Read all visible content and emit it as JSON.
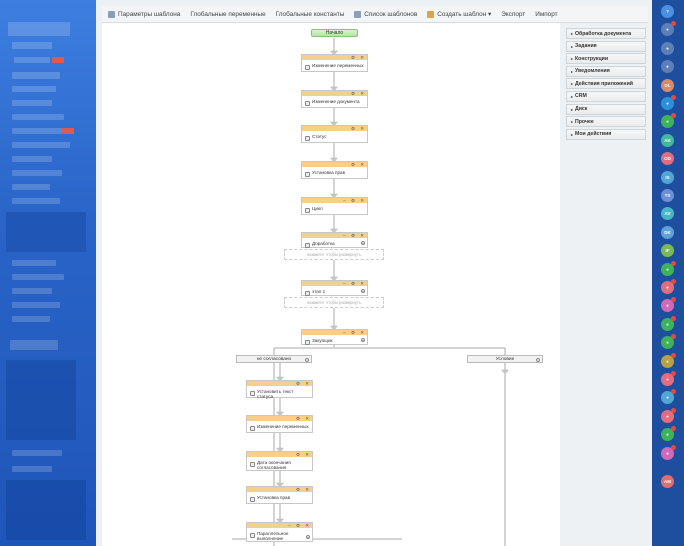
{
  "toolbar": [
    {
      "label": "Параметры шаблона",
      "icon": "settings-icon",
      "color": "#8aa0b8"
    },
    {
      "label": "Глобальные переменные",
      "icon": "",
      "color": ""
    },
    {
      "label": "Глобальные константы",
      "icon": "",
      "color": ""
    },
    {
      "label": "Список шаблонов",
      "icon": "list-icon",
      "color": "#8aa0b8"
    },
    {
      "label": "Создать шаблон ▾",
      "icon": "new-template-icon",
      "color": "#d9a44a"
    },
    {
      "label": "Экспорт",
      "icon": "",
      "color": ""
    },
    {
      "label": "Импорт",
      "icon": "",
      "color": ""
    }
  ],
  "palette": [
    "Обработка документа",
    "Задания",
    "Конструкции",
    "Уведомления",
    "Действия приложений",
    "CRM",
    "Диск",
    "Прочее",
    "Мои действия"
  ],
  "workflow": {
    "start": "Начало",
    "blocks": [
      {
        "title": "Изменение переменных"
      },
      {
        "title": "Изменение документа"
      },
      {
        "title": "Статус"
      },
      {
        "title": "Установка прав"
      },
      {
        "title": "Цикл"
      },
      {
        "title": "Доработка"
      },
      {
        "title": "этап 1"
      },
      {
        "title": "Закупщик"
      }
    ],
    "expand_hint": "нажмите, чтобы развернуть",
    "branches": [
      "не согласовано",
      "Условие"
    ],
    "left_branch_blocks": [
      {
        "title": "Установить текст статуса"
      },
      {
        "title": "Изменение переменных"
      },
      {
        "title": "Дата окончания согласования"
      },
      {
        "title": "Установка прав"
      },
      {
        "title": "Параллельное выполнение"
      }
    ]
  },
  "rail": [
    {
      "text": "?",
      "color": "#4a90e2",
      "badge": false
    },
    {
      "text": "",
      "color": "#5d7fb8",
      "badge": true
    },
    {
      "text": "",
      "color": "#5d7fb8",
      "badge": false
    },
    {
      "text": "",
      "color": "#5d7fb8",
      "badge": false
    },
    {
      "text": "DL",
      "color": "#d98a6b",
      "badge": false
    },
    {
      "text": "",
      "color": "#2d8fd8",
      "badge": true
    },
    {
      "text": "",
      "color": "#3fb35a",
      "badge": true
    },
    {
      "text": "AK",
      "color": "#42b99a",
      "badge": false
    },
    {
      "text": "OD",
      "color": "#e36d80",
      "badge": false
    },
    {
      "text": "IS",
      "color": "#52a6d6",
      "badge": false
    },
    {
      "text": "TS",
      "color": "#6c8fd6",
      "badge": false
    },
    {
      "text": "AV",
      "color": "#49b6c6",
      "badge": false
    },
    {
      "text": "DK",
      "color": "#5fa0d8",
      "badge": false
    },
    {
      "text": "IF",
      "color": "#7ab85a",
      "badge": false
    },
    {
      "text": "",
      "color": "#3fb35a",
      "badge": true
    },
    {
      "text": "",
      "color": "#e36d80",
      "badge": true
    },
    {
      "text": "",
      "color": "#d06ab8",
      "badge": true
    },
    {
      "text": "",
      "color": "#3fb35a",
      "badge": true
    },
    {
      "text": "",
      "color": "#3fb35a",
      "badge": true
    },
    {
      "text": "",
      "color": "#b8a045",
      "badge": true
    },
    {
      "text": "",
      "color": "#e36d80",
      "badge": true
    },
    {
      "text": "",
      "color": "#52a6d6",
      "badge": true
    },
    {
      "text": "",
      "color": "#e36d80",
      "badge": true
    },
    {
      "text": "",
      "color": "#3fb35a",
      "badge": true
    },
    {
      "text": "",
      "color": "#d06ab8",
      "badge": true
    },
    {
      "text": "AM",
      "color": "#e36d6d",
      "badge": false
    }
  ]
}
